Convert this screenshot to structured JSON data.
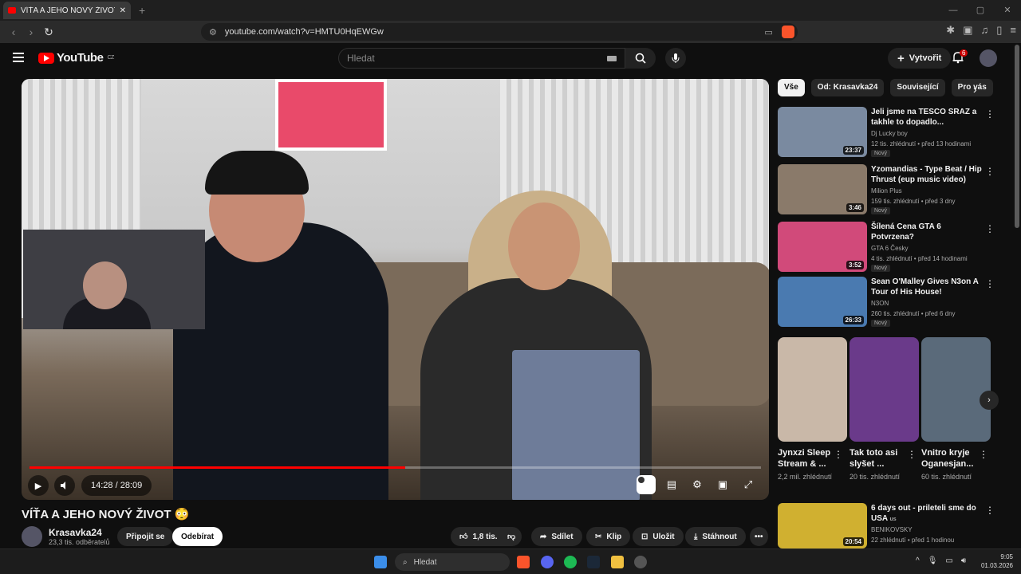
{
  "browser": {
    "tab_title": "VÍŤA A JEHO NOVÝ ŽIVOT 😳 - Yo",
    "url": "youtube.com/watch?v=HMTU0HqEWGw",
    "new_tab": "+",
    "close": "✕"
  },
  "youtube": {
    "logo": "YouTube",
    "region": "CZ",
    "search_placeholder": "Hledat",
    "create_label": "Vytvořit",
    "notif_count": "6"
  },
  "player": {
    "time": "14:28 / 28:09",
    "progress_fraction": 0.514
  },
  "video": {
    "title": "VÍŤA A JEHO NOVÝ ŽIVOT 😳",
    "channel": "Krasavka24",
    "subscribers": "23,3 tis. odběratelů",
    "join_label": "Připojit se",
    "subscribe_label": "Odebírat",
    "like_count": "1,8 tis.",
    "share_label": "Sdílet",
    "clip_label": "Klip",
    "save_label": "Uložit",
    "download_label": "Stáhnout"
  },
  "chips": [
    "Vše",
    "Od: Krasavka24",
    "Související",
    "Pro vás"
  ],
  "recommendations": [
    {
      "title": "Jeli jsme na TESCO SRAZ a takhle to dopadlo...",
      "channel": "Dj Lucky boy",
      "meta": "12 tis. zhlédnutí • před 13 hodinami",
      "duration": "23:37",
      "badge": "Nový",
      "color": "#7a8aa0"
    },
    {
      "title": "Yzomandias - Type Beat / Hip Thrust (eup music video)",
      "channel": "Milion Plus",
      "meta": "159 tis. zhlédnutí • před 3 dny",
      "duration": "3:46",
      "badge": "Nový",
      "color": "#8a7a6a"
    },
    {
      "title": "Šílená Cena GTA 6 Potvrzena?",
      "channel": "GTA 6 Česky",
      "meta": "4 tis. zhlédnutí • před 14 hodinami",
      "duration": "3:52",
      "badge": "Nový",
      "color": "#d14a7a"
    },
    {
      "title": "Sean O'Malley Gives N3on A Tour of His House!",
      "channel": "N3ON",
      "meta": "260 tis. zhlédnutí • před 6 dny",
      "duration": "26:33",
      "badge": "Nový",
      "color": "#4a7ab0"
    }
  ],
  "shorts": [
    {
      "title": "Jynxzi Sleep Stream & ...",
      "views": "2,2 mil. zhlédnutí",
      "color": "#c9b8a8"
    },
    {
      "title": "Tak toto asi slyšet ...",
      "views": "20 tis. zhlédnutí",
      "color": "#6a3a8a"
    },
    {
      "title": "Vnitro kryje Oganesjan...",
      "views": "60 tis. zhlédnutí",
      "color": "#5a6a7a"
    }
  ],
  "last_rec": {
    "title": "6 days out - prileteli sme do USA",
    "flag": "us",
    "channel": "BENIKOVSKY",
    "meta": "22 zhlédnutí • před 1 hodinou",
    "duration": "20:54",
    "color": "#d0b030"
  },
  "taskbar": {
    "search": "Hledat",
    "time": "9:05",
    "date": "01.03.2026"
  }
}
